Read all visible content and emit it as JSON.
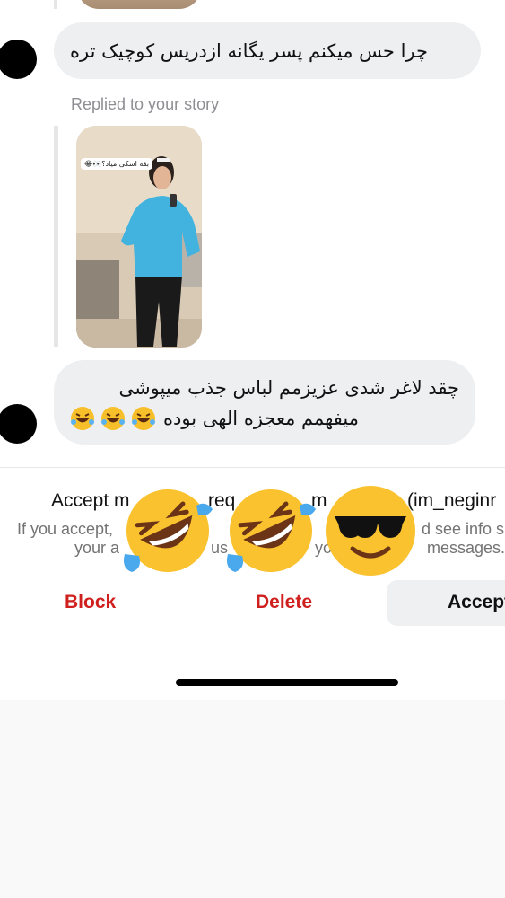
{
  "messages": [
    {
      "text": "چرا حس میکنم پسر یگانه ازدریس کوچیک تره"
    },
    {
      "line1": "چقد لاغر شدی عزیزمم لباس جذب میپوشی",
      "line2": "میفهمم معجزه الهی بوده",
      "emojis": "🤣🤣🤣"
    }
  ],
  "reply_label": "Replied to your story",
  "story": {
    "sticker_text": "بقه اسکی میاد؟👀😂"
  },
  "request": {
    "title_left": "Accept m",
    "title_mid": "req",
    "title_mid2": "m",
    "title_right": "(im_neginr",
    "desc_left": "If you accept,",
    "desc_right": "d see info su",
    "desc2_left": "your a",
    "desc2_mid": "us",
    "desc2_mid2": "yo",
    "desc2_right": "messages."
  },
  "overlay_emojis": [
    "rolling-on-floor-laughing",
    "rolling-on-floor-laughing",
    "smiling-face-with-sunglasses"
  ],
  "buttons": {
    "block": "Block",
    "delete": "Delete",
    "accept": "Accept"
  },
  "colors": {
    "danger": "#d0201e",
    "bubble": "#eeeff1",
    "muted": "#8e8e93"
  }
}
